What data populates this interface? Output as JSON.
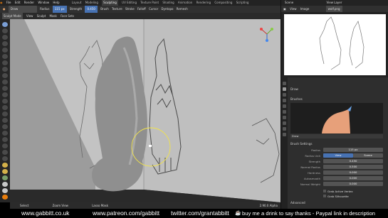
{
  "topbar": {
    "menus": [
      "File",
      "Edit",
      "Render",
      "Window",
      "Help"
    ],
    "workspaces": [
      "Layout",
      "Modeling",
      "Sculpting",
      "UV Editing",
      "Texture Paint",
      "Shading",
      "Animation",
      "Rendering",
      "Compositing",
      "Scripting"
    ],
    "active_workspace": "Sculpting",
    "scene": "Scene",
    "view_layer": "View Layer"
  },
  "header": {
    "brush": "Draw",
    "radius_label": "Radius",
    "radius_value": "115 px",
    "strength_label": "Strength",
    "strength_value": "0.450",
    "brush_menu": "Brush",
    "texture_menu": "Texture",
    "stroke_menu": "Stroke",
    "falloff_menu": "Falloff",
    "cursor_menu": "Cursor",
    "dyntopo": "Dyntopo",
    "remesh": "Remesh"
  },
  "subheader": {
    "mode": "Sculpt Mode",
    "items": [
      "View",
      "Sculpt",
      "Mask",
      "Face Sets"
    ]
  },
  "image_editor": {
    "items": [
      "View",
      "Image"
    ],
    "image_name": "wolf.png"
  },
  "properties": {
    "object_name": "Draw",
    "brushes_section": "Brushes",
    "brush_name": "Draw",
    "brush_settings_section": "Brush Settings",
    "rows": [
      {
        "label": "Radius",
        "value": "115 px"
      },
      {
        "label": "Radius Unit",
        "value": "View",
        "value2": "Scene"
      },
      {
        "label": "Strength",
        "value": "0.450"
      },
      {
        "label": "Normal Radius",
        "value": "0.500"
      },
      {
        "label": "Hardness",
        "value": "0.000"
      },
      {
        "label": "Autosmooth",
        "value": "0.000"
      },
      {
        "label": "Normal Weight",
        "value": "0.000"
      }
    ],
    "checkbox1": "Grab Active Vertex",
    "checkbox2": "Grab Silhouette",
    "advanced": "Advanced"
  },
  "statusbar": {
    "items": [
      "Select",
      "Zoom View",
      "Lasso Mask"
    ],
    "version": "2.90.0 Alpha"
  },
  "footer": {
    "site": "www.gabbitt.co.uk",
    "patreon": "www.patreon.com/gabbitt",
    "twitter": "twitter.com/grantabbitt",
    "message": "buy me a drink to say thanks - Paypal link in description"
  }
}
